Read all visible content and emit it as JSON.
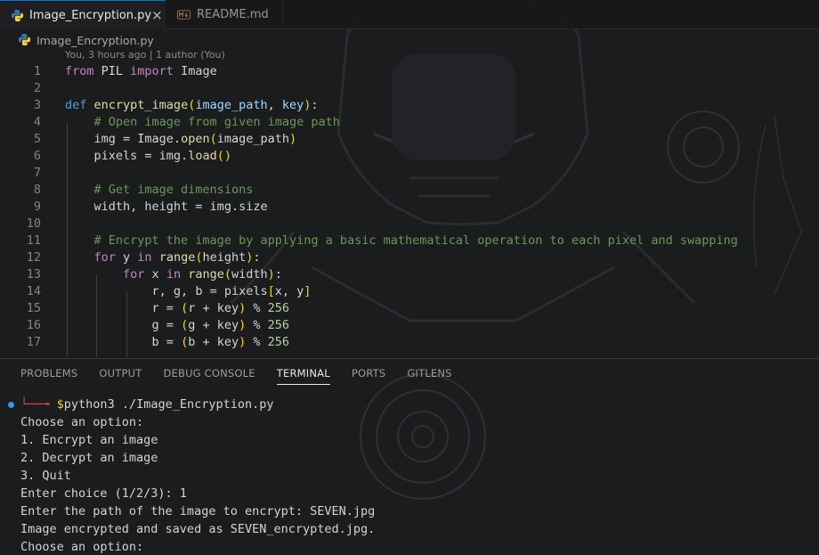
{
  "tabs": [
    {
      "label": "Image_Encryption.py",
      "icon": "python-icon",
      "active": true
    },
    {
      "label": "README.md",
      "icon": "markdown-icon",
      "active": false
    }
  ],
  "breadcrumb": {
    "file": "Image_Encryption.py"
  },
  "codelens": "You, 3 hours ago | 1 author (You)",
  "line_numbers": [
    "1",
    "2",
    "3",
    "4",
    "5",
    "6",
    "7",
    "8",
    "9",
    "10",
    "11",
    "12",
    "13",
    "14",
    "15",
    "16",
    "17"
  ],
  "code": {
    "l1": {
      "kw": "from",
      "a": " PIL ",
      "kw2": "import",
      "b": " Image"
    },
    "l3": {
      "kw": "def",
      "fn": "encrypt_image",
      "p1": "image_path",
      "sep": ", ",
      "p2": "key"
    },
    "l4": "# Open image from given image path",
    "l5": {
      "a": "img = Image.",
      "fn": "open",
      "p": "image_path"
    },
    "l6": {
      "a": "pixels = img.",
      "fn": "load"
    },
    "l8": "# Get image dimensions",
    "l9": "width, height = img.size",
    "l11": "# Encrypt the image by applying a basic mathematical operation to each pixel and swapping",
    "l12": {
      "kw": "for",
      "a": " y ",
      "kw2": "in",
      "fn": "range",
      "b": "height"
    },
    "l13": {
      "kw": "for",
      "a": " x ",
      "kw2": "in",
      "fn": "range",
      "b": "width"
    },
    "l14": {
      "a": "r, g, b = pixels",
      "b": "x, y"
    },
    "l15": {
      "a": "r = ",
      "b": "r + key",
      "c": " % ",
      "n": "256"
    },
    "l16": {
      "a": "g = ",
      "b": "g + key",
      "c": " % ",
      "n": "256"
    },
    "l17": {
      "a": "b = ",
      "b": "b + key",
      "c": " % ",
      "n": "256"
    }
  },
  "panel_tabs": [
    "PROBLEMS",
    "OUTPUT",
    "DEBUG CONSOLE",
    "TERMINAL",
    "PORTS",
    "GITLENS"
  ],
  "active_panel_tab": "TERMINAL",
  "terminal": {
    "prompt_arrow": "└──╼",
    "prompt_dollar": "$",
    "command": "python3 ./Image_Encryption.py",
    "lines": [
      "Choose an option:",
      "1. Encrypt an image",
      "2. Decrypt an image",
      "3. Quit",
      "Enter choice (1/2/3): 1",
      "Enter the path of the image to encrypt: SEVEN.jpg",
      "Image encrypted and saved as SEVEN_encrypted.jpg.",
      "Choose an option:"
    ]
  },
  "colors": {
    "accent": "#0078d4",
    "keyword": "#c586c0",
    "function": "#dcdcaa",
    "comment": "#6a9955",
    "number": "#b5cea8",
    "terminal_dot": "#3794ff"
  }
}
